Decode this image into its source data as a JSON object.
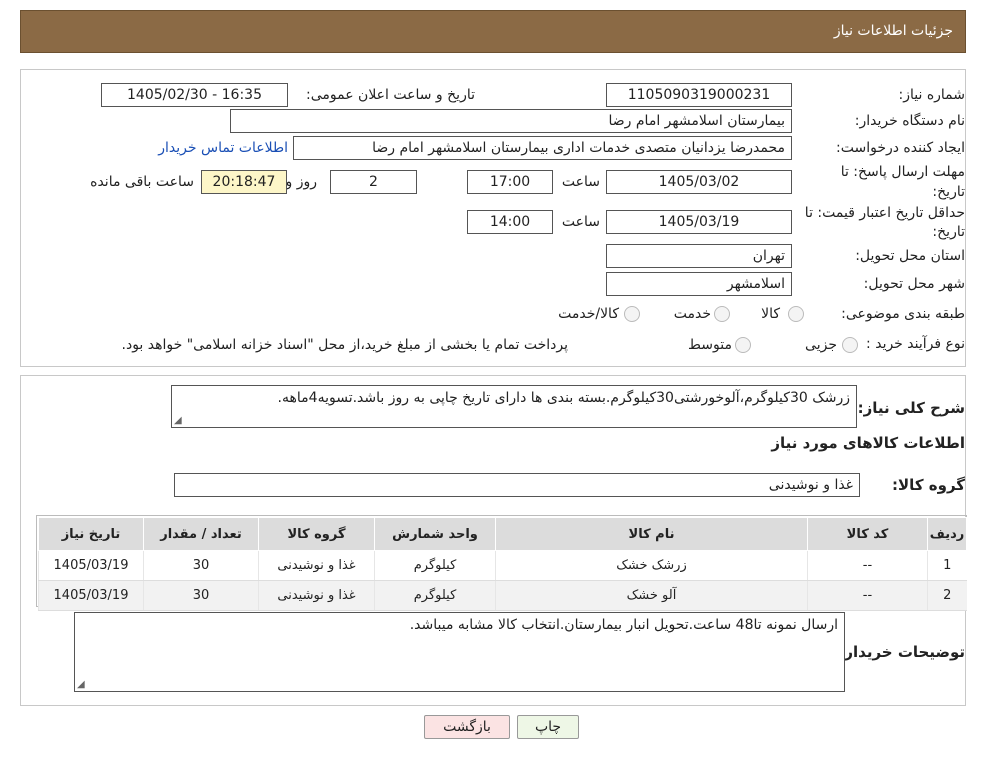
{
  "header": {
    "title": "جزئیات اطلاعات نیاز"
  },
  "form": {
    "need_number_label": "شماره نیاز:",
    "need_number": "1105090319000231",
    "announce_label": "تاریخ و ساعت اعلان عمومی:",
    "announce_value": "1405/02/30 - 16:35",
    "buyer_org_label": "نام دستگاه خریدار:",
    "buyer_org": "بیمارستان اسلامشهر   امام رضا",
    "requester_label": "ایجاد کننده درخواست:",
    "requester": "محمدرضا یزدانیان متصدی خدمات اداری بیمارستان اسلامشهر   امام رضا",
    "contact_link": "اطلاعات تماس خریدار",
    "deadline_label_1": "مهلت ارسال پاسخ: تا",
    "deadline_label_2": "تاریخ:",
    "deadline_date": "1405/03/02",
    "time_label": "ساعت",
    "deadline_time": "17:00",
    "days_value": "2",
    "days_label": "روز و",
    "remaining_time": "20:18:47",
    "remaining_label": "ساعت باقی مانده",
    "validity_label_1": "حداقل تاریخ اعتبار قیمت: تا",
    "validity_label_2": "تاریخ:",
    "validity_date": "1405/03/19",
    "validity_time_label": "ساعت",
    "validity_time": "14:00",
    "province_label": "استان محل تحویل:",
    "province": "تهران",
    "city_label": "شهر محل تحویل:",
    "city": "اسلامشهر",
    "category_label": "طبقه بندی موضوعی:",
    "category_options": [
      "کالا",
      "خدمت",
      "کالا/خدمت"
    ],
    "process_label": "نوع فرآیند خرید :",
    "process_options": [
      "جزیی",
      "متوسط"
    ],
    "process_note": "پرداخت تمام یا بخشی از مبلغ خرید،از محل \"اسناد خزانه اسلامی\" خواهد بود."
  },
  "summary": {
    "description_label": "شرح کلی نیاز:",
    "description": "زرشک 30کیلوگرم،آلوخورشتی30کیلوگرم.بسته بندی ها دارای تاریخ چاپی به روز باشد.تسویه4ماهه.",
    "goods_info_title": "اطلاعات کالاهای مورد نیاز",
    "goods_group_label": "گروه کالا:",
    "goods_group": "غذا و نوشیدنی"
  },
  "table": {
    "columns": [
      "ردیف",
      "کد کالا",
      "نام کالا",
      "واحد شمارش",
      "گروه کالا",
      "تعداد / مقدار",
      "تاریخ نیاز"
    ],
    "rows": [
      [
        "1",
        "--",
        "زرشک خشک",
        "کیلوگرم",
        "غذا و نوشیدنی",
        "30",
        "1405/03/19"
      ],
      [
        "2",
        "--",
        "آلو خشک",
        "کیلوگرم",
        "غذا و نوشیدنی",
        "30",
        "1405/03/19"
      ]
    ]
  },
  "notes": {
    "label": "توضیحات خریدار:",
    "text": "ارسال نمونه تا48 ساعت.تحویل انبار بیمارستان.انتخاب کالا مشابه میباشد."
  },
  "buttons": {
    "print": "چاپ",
    "back": "بازگشت"
  },
  "colors": {
    "header_bg": "#8b6a45",
    "link": "#1a4fb5",
    "back_button_bg": "#fbe3e3",
    "print_button_bg": "#eef7e6",
    "remaining_bg": "#fdf6c8"
  }
}
